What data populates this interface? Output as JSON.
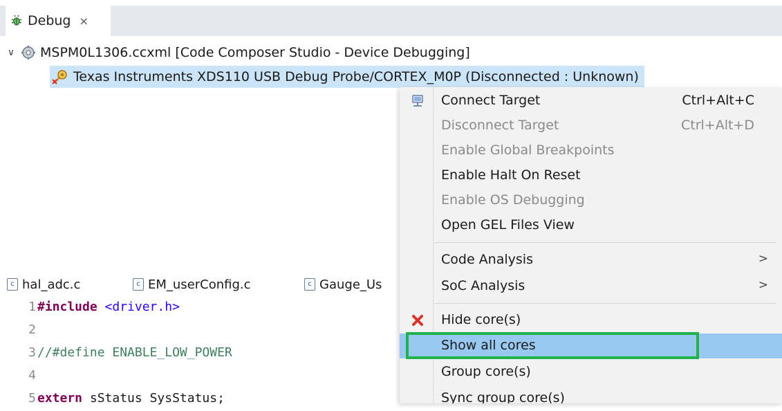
{
  "debug_view": {
    "tab_label": "Debug",
    "tab_close": "×",
    "tree": {
      "session": "MSPM0L1306.ccxml [Code Composer Studio - Device Debugging]",
      "probe_visible": "Texas Instruments XDS110 USB Debug Probe/CORTEX_M0P (Disconnected : Unknown)"
    }
  },
  "editor": {
    "tabs": [
      {
        "label": "hal_adc.c",
        "icon": "c-file-icon"
      },
      {
        "label": "EM_userConfig.c",
        "icon": "c-file-icon"
      },
      {
        "label": "Gauge_Us",
        "icon": "c-file-icon"
      }
    ],
    "lines": [
      {
        "n": "1",
        "kw": "#include",
        "rest": " <driver.h>"
      },
      {
        "n": "2",
        "kw": "",
        "rest": ""
      },
      {
        "n": "3",
        "kw": "",
        "rest": "//#define ENABLE_LOW_POWER"
      },
      {
        "n": "4",
        "kw": "",
        "rest": ""
      },
      {
        "n": "5",
        "kw": "extern",
        "rest": " sStatus SysStatus;"
      }
    ]
  },
  "context_menu": {
    "items": [
      {
        "label": "Connect Target",
        "accel": "Ctrl+Alt+C",
        "enabled": true,
        "icon": "connect-target-icon"
      },
      {
        "label": "Disconnect Target",
        "accel": "Ctrl+Alt+D",
        "enabled": false
      },
      {
        "label": "Enable Global Breakpoints",
        "accel": "",
        "enabled": false
      },
      {
        "label": "Enable Halt On Reset",
        "accel": "",
        "enabled": true
      },
      {
        "label": "Enable OS Debugging",
        "accel": "",
        "enabled": false
      },
      {
        "label": "Open GEL Files View",
        "accel": "",
        "enabled": true
      },
      {
        "label": "Code Analysis",
        "accel": "",
        "enabled": true,
        "submenu": true
      },
      {
        "label": "SoC Analysis",
        "accel": "",
        "enabled": true,
        "submenu": true
      },
      {
        "label": "Hide core(s)",
        "accel": "",
        "enabled": true,
        "icon": "red-x-icon"
      },
      {
        "label": "Show all cores",
        "accel": "",
        "enabled": true,
        "highlighted": true
      },
      {
        "label": "Group core(s)",
        "accel": "",
        "enabled": true
      },
      {
        "label": "Sync group core(s)",
        "accel": "",
        "enabled": true
      }
    ],
    "submenu_arrow": ">",
    "highlight_color": "#22b14c",
    "selection_color": "#99c9f1"
  }
}
